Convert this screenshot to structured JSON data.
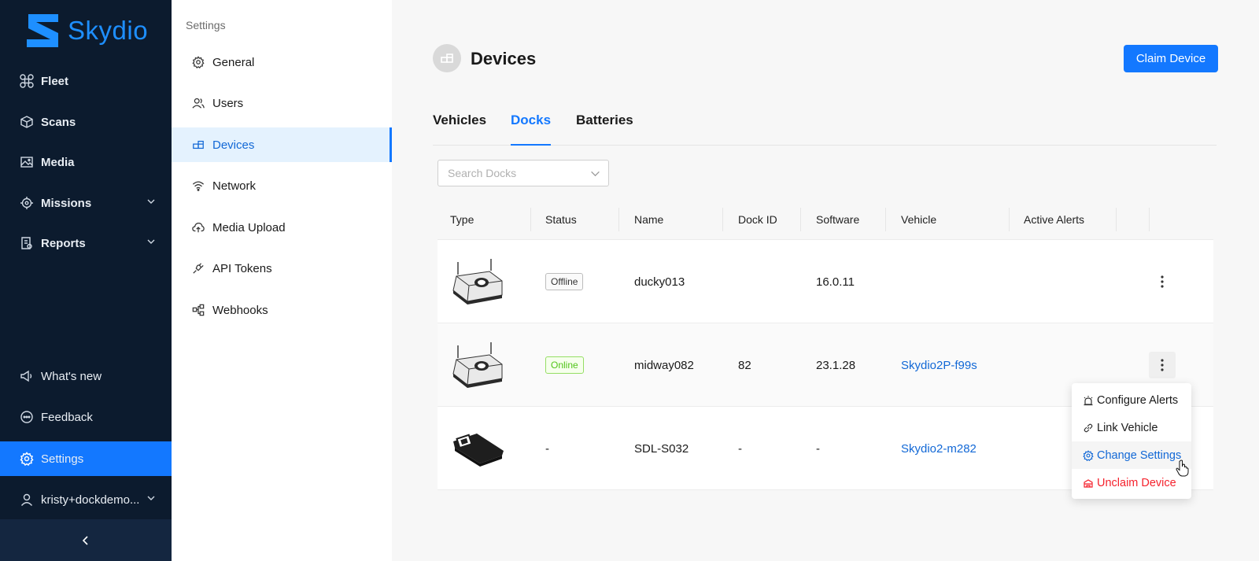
{
  "brand": {
    "name": "Skydio",
    "color": "#1e8fff"
  },
  "colors": {
    "nav_bg": "#0c1b2e",
    "accent": "#1378ff",
    "online": "#52c41a",
    "danger": "#f5222d"
  },
  "nav": {
    "items": [
      {
        "label": "Fleet",
        "icon": "drone-icon"
      },
      {
        "label": "Scans",
        "icon": "cube-icon"
      },
      {
        "label": "Media",
        "icon": "image-icon"
      },
      {
        "label": "Missions",
        "icon": "target-icon",
        "expandable": true
      },
      {
        "label": "Reports",
        "icon": "report-icon",
        "expandable": true
      }
    ],
    "bottom": [
      {
        "label": "What's new",
        "icon": "megaphone-icon"
      },
      {
        "label": "Feedback",
        "icon": "chat-icon"
      },
      {
        "label": "Settings",
        "icon": "gear-icon",
        "active": true
      },
      {
        "label": "kristy+dockdemo...",
        "icon": "user-icon",
        "expandable": true
      }
    ]
  },
  "settings": {
    "title": "Settings",
    "items": [
      {
        "label": "General",
        "icon": "gear-icon"
      },
      {
        "label": "Users",
        "icon": "users-icon"
      },
      {
        "label": "Devices",
        "icon": "devices-icon",
        "active": true
      },
      {
        "label": "Network",
        "icon": "wifi-icon"
      },
      {
        "label": "Media Upload",
        "icon": "cloud-upload-icon"
      },
      {
        "label": "API Tokens",
        "icon": "plug-icon"
      },
      {
        "label": "Webhooks",
        "icon": "webhook-icon"
      }
    ]
  },
  "main": {
    "title": "Devices",
    "claim_button": "Claim Device",
    "tabs": [
      {
        "label": "Vehicles"
      },
      {
        "label": "Docks",
        "active": true
      },
      {
        "label": "Batteries"
      }
    ],
    "search": {
      "placeholder": "Search Docks"
    },
    "table": {
      "columns": [
        "Type",
        "Status",
        "Name",
        "Dock ID",
        "Software",
        "Vehicle",
        "Active Alerts"
      ],
      "rows": [
        {
          "type_icon": "dock-icon",
          "status": "Offline",
          "name": "ducky013",
          "dock_id": "",
          "software": "16.0.11",
          "vehicle": ""
        },
        {
          "type_icon": "dock-icon",
          "status": "Online",
          "name": "midway082",
          "dock_id": "82",
          "software": "23.1.28",
          "vehicle": "Skydio2P-f99s"
        },
        {
          "type_icon": "controller-icon",
          "status": "-",
          "name": "SDL-S032",
          "dock_id": "-",
          "software": "-",
          "vehicle": "Skydio2-m282"
        }
      ]
    },
    "context_menu": {
      "items": [
        {
          "label": "Configure Alerts",
          "icon": "alarm-icon"
        },
        {
          "label": "Link Vehicle",
          "icon": "link-icon"
        },
        {
          "label": "Change Settings",
          "icon": "gear-icon",
          "active": true
        },
        {
          "label": "Unclaim Device",
          "icon": "unclaim-icon",
          "danger": true
        }
      ]
    }
  }
}
